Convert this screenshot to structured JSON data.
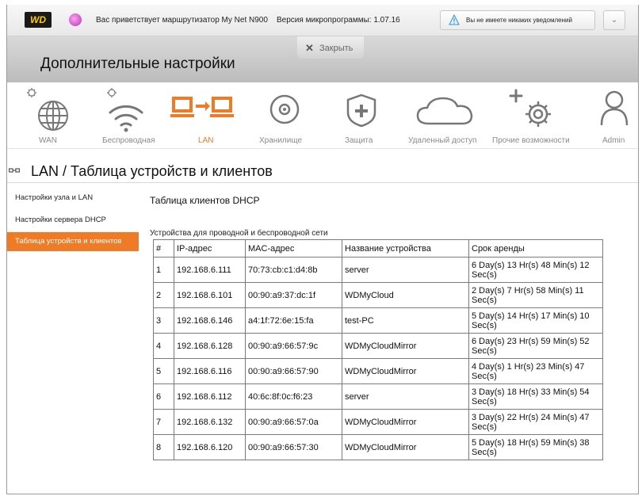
{
  "topbar": {
    "logo": "WD",
    "welcome": "Вас приветствует маршрутизатор My Net N900",
    "firmware": "Версия микропрограммы: 1.07.16",
    "notification": "Вы не имеете никаких уведомлений",
    "notification_dropdown": "⌄"
  },
  "header": {
    "title": "Дополнительные настройки",
    "close_icon": "✕",
    "close_label": "Закрыть"
  },
  "nav": {
    "active_color": "#f07b27",
    "items": [
      {
        "label": "WAN",
        "icon": "globe-icon"
      },
      {
        "label": "Беспроводная",
        "icon": "wifi-icon"
      },
      {
        "label": "LAN",
        "icon": "lan-icon"
      },
      {
        "label": "Хранилище",
        "icon": "disc-icon"
      },
      {
        "label": "Защита",
        "icon": "shield-icon"
      },
      {
        "label": "Удаленный доступ",
        "icon": "cloud-icon"
      },
      {
        "label": "Прочие возможности",
        "icon": "gear-plus-icon"
      },
      {
        "label": "Admin",
        "icon": "user-icon"
      }
    ]
  },
  "page": {
    "title": "LAN / Таблица устройств и клиентов"
  },
  "sidebar": {
    "items": [
      {
        "label": "Настройки узла и LAN"
      },
      {
        "label": "Настройки сервера DHCP"
      },
      {
        "label": "Таблица устройств и клиентов"
      }
    ]
  },
  "content": {
    "title": "Таблица клиентов DHCP",
    "subtitle": "Устройства для проводной и беспроводной сети",
    "columns": [
      "#",
      "IP-адрес",
      "MAC-адрес",
      "Название устройства",
      "Срок аренды"
    ],
    "rows": [
      {
        "num": "1",
        "ip": "192.168.6.111",
        "mac": "70:73:cb:c1:d4:8b",
        "name": "server",
        "lease": "6 Day(s) 13 Hr(s) 48 Min(s) 12 Sec(s)"
      },
      {
        "num": "2",
        "ip": "192.168.6.101",
        "mac": "00:90:a9:37:dc:1f",
        "name": "WDMyCloud",
        "lease": "2 Day(s) 7 Hr(s) 58 Min(s) 11 Sec(s)"
      },
      {
        "num": "3",
        "ip": "192.168.6.146",
        "mac": "a4:1f:72:6e:15:fa",
        "name": "test-PC",
        "lease": "5 Day(s) 14 Hr(s) 17 Min(s) 10 Sec(s)"
      },
      {
        "num": "4",
        "ip": "192.168.6.128",
        "mac": "00:90:a9:66:57:9c",
        "name": "WDMyCloudMirror",
        "lease": "6 Day(s) 23 Hr(s) 59 Min(s) 52 Sec(s)"
      },
      {
        "num": "5",
        "ip": "192.168.6.116",
        "mac": "00:90:a9:66:57:90",
        "name": "WDMyCloudMirror",
        "lease": "4 Day(s) 1 Hr(s) 23 Min(s) 47 Sec(s)"
      },
      {
        "num": "6",
        "ip": "192.168.6.112",
        "mac": "40:6c:8f:0c:f6:23",
        "name": "server",
        "lease": "3 Day(s) 18 Hr(s) 33 Min(s) 54 Sec(s)"
      },
      {
        "num": "7",
        "ip": "192.168.6.132",
        "mac": "00:90:a9:66:57:0a",
        "name": "WDMyCloudMirror",
        "lease": "3 Day(s) 22 Hr(s) 24 Min(s) 47 Sec(s)"
      },
      {
        "num": "8",
        "ip": "192.168.6.120",
        "mac": "00:90:a9:66:57:30",
        "name": "WDMyCloudMirror",
        "lease": "5 Day(s) 18 Hr(s) 59 Min(s) 38 Sec(s)"
      }
    ]
  }
}
